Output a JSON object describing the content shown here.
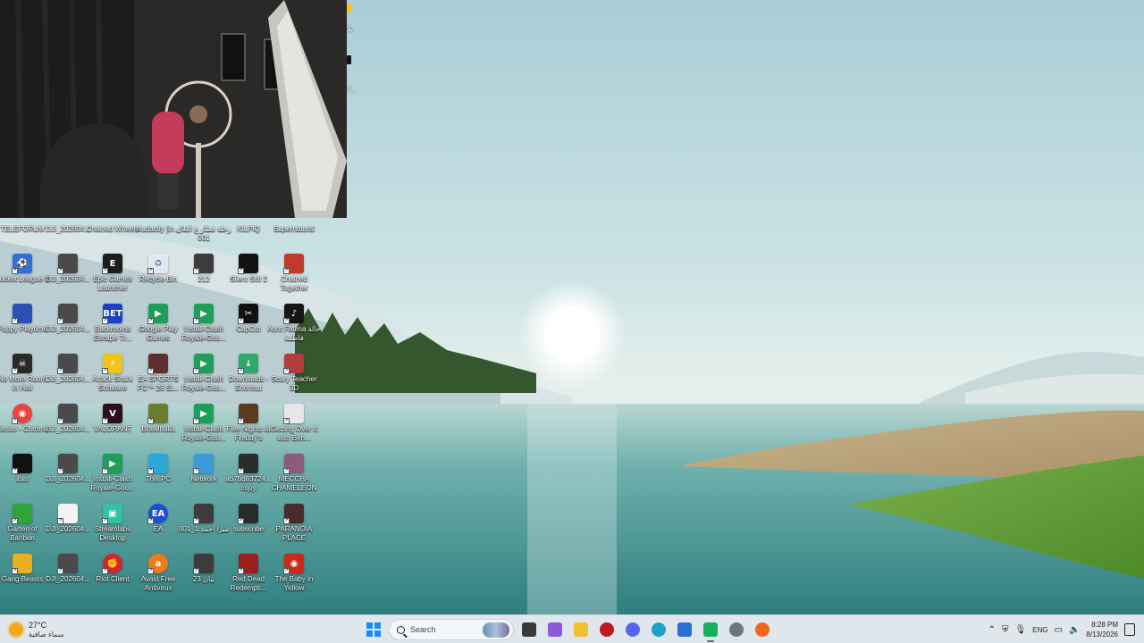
{
  "desktop": {
    "icons": [
      {
        "label": "TELEFORUM",
        "icon": "app-icon",
        "color": "#d93a2f",
        "glyph": ""
      },
      {
        "label": "DJI_202604...",
        "icon": "video-thumbnail-icon",
        "color": "#4a4a4a",
        "glyph": ""
      },
      {
        "label": "Chained Wheels",
        "icon": "game-icon",
        "color": "#7a5a2e",
        "glyph": ""
      },
      {
        "label": "Audacity [in...",
        "icon": "audacity-icon",
        "color": "#f2b21e",
        "glyph": ""
      },
      {
        "label": "رحلة قطار ع التلال 001",
        "icon": "video-thumbnail-icon",
        "color": "#3c3c3c",
        "glyph": ""
      },
      {
        "label": "KILPIQ",
        "icon": "game-icon",
        "color": "#8a6b1c",
        "glyph": ""
      },
      {
        "label": "Supernatural",
        "icon": "game-icon",
        "color": "#3b5a32",
        "glyph": ""
      },
      {
        "label": "Rocket League ®",
        "icon": "rocket-league-icon",
        "color": "#2f6fd6",
        "glyph": "⚽"
      },
      {
        "label": "DJI_202604...",
        "icon": "video-thumbnail-icon",
        "color": "#4a4a4a",
        "glyph": ""
      },
      {
        "label": "Epic Games Launcher",
        "icon": "epic-games-icon",
        "color": "#1c1c1c",
        "glyph": "E"
      },
      {
        "label": "Recycle Bin",
        "icon": "recycle-bin-icon",
        "color": "#dfe9ef",
        "glyph": "♻"
      },
      {
        "label": "212",
        "icon": "video-thumbnail-icon",
        "color": "#3c3c3c",
        "glyph": ""
      },
      {
        "label": "Silent Still 2",
        "icon": "game-icon",
        "color": "#111111",
        "glyph": ""
      },
      {
        "label": "Chained Together",
        "icon": "game-icon",
        "color": "#c23a2a",
        "glyph": ""
      },
      {
        "label": "Poppy Playtime",
        "icon": "game-icon",
        "color": "#2b4fb3",
        "glyph": ""
      },
      {
        "label": "DJI_202604...",
        "icon": "video-thumbnail-icon",
        "color": "#4a4a4a",
        "glyph": ""
      },
      {
        "label": "Backrooms Escape Tr...",
        "icon": "game-icon",
        "color": "#1c3fc4",
        "glyph": "BET"
      },
      {
        "label": "Google Play Games",
        "icon": "google-play-games-icon",
        "color": "#1f9e5a",
        "glyph": "▶"
      },
      {
        "label": "Install-Clash Royale-Goo...",
        "icon": "google-play-games-icon",
        "color": "#1f9e5a",
        "glyph": "▶"
      },
      {
        "label": "CapCut",
        "icon": "capcut-icon",
        "color": "#111111",
        "glyph": "✂"
      },
      {
        "label": "Aunt Fatima خالة فاطمة",
        "icon": "game-icon",
        "color": "#161616",
        "glyph": "♪"
      },
      {
        "label": "No More Room in Hell",
        "icon": "game-icon",
        "color": "#2a2a2a",
        "glyph": "☠"
      },
      {
        "label": "DJI_202604...",
        "icon": "video-thumbnail-icon",
        "color": "#4a4a4a",
        "glyph": ""
      },
      {
        "label": "Attack Shark Software",
        "icon": "app-icon",
        "color": "#f0c419",
        "glyph": "⚡"
      },
      {
        "label": "EA SPORTS FC™ 26 St...",
        "icon": "game-icon",
        "color": "#5b2f2f",
        "glyph": ""
      },
      {
        "label": "Install-Clash Royale-Goo...",
        "icon": "google-play-games-icon",
        "color": "#1f9e5a",
        "glyph": "▶"
      },
      {
        "label": "Downloads - Shortcut",
        "icon": "downloads-icon",
        "color": "#2fa86b",
        "glyph": "↓"
      },
      {
        "label": "Scary Teacher 3D",
        "icon": "game-icon",
        "color": "#b43c3c",
        "glyph": ""
      },
      {
        "label": "Kenan - Chrome",
        "icon": "chrome-icon",
        "color": "#e8453c",
        "glyph": "◉"
      },
      {
        "label": "DJI_202604...",
        "icon": "video-thumbnail-icon",
        "color": "#4a4a4a",
        "glyph": ""
      },
      {
        "label": "VALORANT",
        "icon": "valorant-icon",
        "color": "#2a0f1d",
        "glyph": "V"
      },
      {
        "label": "Brawlhalla",
        "icon": "game-icon",
        "color": "#6b7d2e",
        "glyph": ""
      },
      {
        "label": "Install-Clash Royale-Goo...",
        "icon": "google-play-games-icon",
        "color": "#1f9e5a",
        "glyph": "▶"
      },
      {
        "label": "Five Nights at Freddy's",
        "icon": "game-icon",
        "color": "#5b3a1e",
        "glyph": ""
      },
      {
        "label": "Getting Over It with Ben...",
        "icon": "game-icon",
        "color": "#e6e6e6",
        "glyph": ""
      },
      {
        "label": "ibiis",
        "icon": "app-icon",
        "color": "#111111",
        "glyph": ""
      },
      {
        "label": "DJI_202604...",
        "icon": "video-thumbnail-icon",
        "color": "#4a4a4a",
        "glyph": ""
      },
      {
        "label": "Install-Clash Royale-Goo...",
        "icon": "google-play-games-icon",
        "color": "#1f9e5a",
        "glyph": "▶"
      },
      {
        "label": "This PC",
        "icon": "monitor-icon",
        "color": "#2fa6d8",
        "glyph": ""
      },
      {
        "label": "Network",
        "icon": "network-icon",
        "color": "#3a9bd8",
        "glyph": ""
      },
      {
        "label": "ab7bd83724... copy",
        "icon": "video-thumbnail-icon",
        "color": "#2c2c2c",
        "glyph": ""
      },
      {
        "label": "MECCHA CHAMELEON",
        "icon": "game-icon",
        "color": "#8c5a7a",
        "glyph": ""
      },
      {
        "label": "Garten of Banban",
        "icon": "game-icon",
        "color": "#2ea43a",
        "glyph": ""
      },
      {
        "label": "DJI_202604...",
        "icon": "document-icon",
        "color": "#f4f4f4",
        "glyph": ""
      },
      {
        "label": "Streamlabs Desktop",
        "icon": "streamlabs-icon",
        "color": "#31c3a2",
        "glyph": "▣"
      },
      {
        "label": "EA",
        "icon": "ea-icon",
        "color": "#1d4fd8",
        "glyph": "EA"
      },
      {
        "label": "ميرا احمد 1_001",
        "icon": "video-thumbnail-icon",
        "color": "#3c3c3c",
        "glyph": ""
      },
      {
        "label": "subscribe",
        "icon": "video-thumbnail-icon",
        "color": "#2a2a2a",
        "glyph": ""
      },
      {
        "label": "PARANOIA PLACE",
        "icon": "game-icon",
        "color": "#4a2a2a",
        "glyph": ""
      },
      {
        "label": "Gang Beasts",
        "icon": "game-icon",
        "color": "#e6b020",
        "glyph": ""
      },
      {
        "label": "DJI_202604...",
        "icon": "video-thumbnail-icon",
        "color": "#4a4a4a",
        "glyph": ""
      },
      {
        "label": "Riot Client",
        "icon": "riot-client-icon",
        "color": "#d8232a",
        "glyph": "✊"
      },
      {
        "label": "Avast Free Antivirus",
        "icon": "avast-icon",
        "color": "#f07a1a",
        "glyph": "a"
      },
      {
        "label": "بيان 23",
        "icon": "video-thumbnail-icon",
        "color": "#3c3c3c",
        "glyph": ""
      },
      {
        "label": "Red Dead Redempti...",
        "icon": "game-icon",
        "color": "#9c1e1e",
        "glyph": ""
      },
      {
        "label": "The Baby in Yellow",
        "icon": "game-icon",
        "color": "#c92a1a",
        "glyph": "◉"
      }
    ]
  },
  "webcam": {
    "edge_texts": [
      "بلا",
      "9..."
    ]
  },
  "taskbar": {
    "weather": {
      "temp": "27°C",
      "condition": "سماء صافية"
    },
    "search_placeholder": "Search",
    "apps": [
      {
        "name": "task-view",
        "color": "#3a3a3a"
      },
      {
        "name": "copilot",
        "color": "#8a5bd6"
      },
      {
        "name": "file-explorer",
        "color": "#f2c12e"
      },
      {
        "name": "app-red-circle",
        "color": "#c0181f"
      },
      {
        "name": "discord",
        "color": "#5865f2"
      },
      {
        "name": "edge",
        "color": "#1fa0c9"
      },
      {
        "name": "microsoft-store",
        "color": "#2a6fd6"
      },
      {
        "name": "android-app",
        "color": "#18b05a"
      },
      {
        "name": "settings",
        "color": "#6b7780"
      },
      {
        "name": "firefox",
        "color": "#f0641e"
      }
    ],
    "tray": {
      "language": "ENG",
      "time": "8:28 PM",
      "date": "8/13/2026"
    }
  }
}
